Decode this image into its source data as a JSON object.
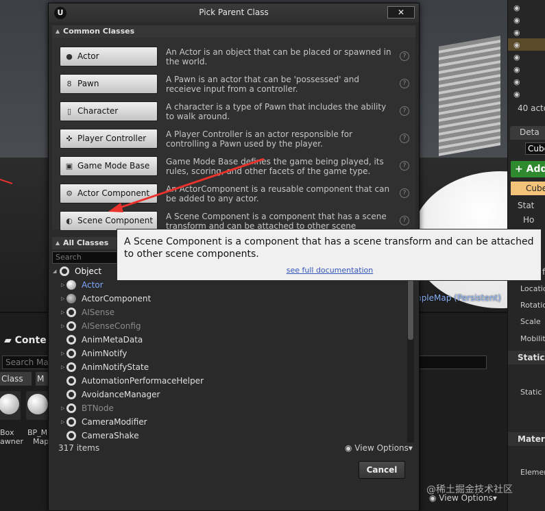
{
  "viewport": {
    "map_label": "mpleMap (Persistent)"
  },
  "right_panel": {
    "outliner_count": "40 acto",
    "details_tab": "Deta",
    "actor_name": "Cube",
    "add_label": "+ Add",
    "selected_component": "Cube",
    "static_section": "Stat",
    "sub_item": "Ho",
    "location": "Location",
    "rotation": "Rotatio",
    "scale": "Scale",
    "mobility": "Mobility",
    "static_mesh_section": "Static",
    "static_mesh_label": "Static M",
    "materials_section": "Materi",
    "element_label": "Elemen",
    "sidebar_letter": "f"
  },
  "content_browser": {
    "tab_label": "Conte",
    "search_placeholder": "Search Map",
    "chip_class": "Class",
    "chip_m": "M",
    "asset1_line1": "Box",
    "asset1_line2": "awner",
    "asset2_line1": "BP_M",
    "asset2_line2": "Map"
  },
  "dialog": {
    "title": "Pick Parent Class",
    "logo": "U",
    "close_label": "✕",
    "common_header": "Common Classes",
    "all_header": "All Classes",
    "search_placeholder": "Search",
    "common_classes": [
      {
        "label": "Actor",
        "icon": "sphere-icon",
        "desc": "An Actor is an object that can be placed or spawned in the world."
      },
      {
        "label": "Pawn",
        "icon": "pawn-icon",
        "desc": "A Pawn is an actor that can be 'possessed' and receieve input from a controller."
      },
      {
        "label": "Character",
        "icon": "character-icon",
        "desc": "A character is a type of Pawn that includes the ability to walk around."
      },
      {
        "label": "Player Controller",
        "icon": "controller-icon",
        "desc": "A Player Controller is an actor responsible for controlling a Pawn used by the player."
      },
      {
        "label": "Game Mode Base",
        "icon": "gamemode-icon",
        "desc": "Game Mode Base defines the game being played, its rules, scoring, and other facets of the game type."
      },
      {
        "label": "Actor Component",
        "icon": "component-icon",
        "desc": "An ActorComponent is a reusable component that can be added to any actor."
      },
      {
        "label": "Scene Component",
        "icon": "scene-component-icon",
        "desc": "A Scene Component is a component that has a scene transform and can be attached to other scene components."
      }
    ],
    "tree": [
      {
        "label": "Object",
        "depth": 0,
        "expand": "open",
        "kind": "ring",
        "color": "#ffffff"
      },
      {
        "label": "Actor",
        "depth": 1,
        "expand": "closed",
        "kind": "ball",
        "color": "#7fa6ff"
      },
      {
        "label": "ActorComponent",
        "depth": 1,
        "expand": "closed",
        "kind": "comp",
        "color": "#e0e0e0"
      },
      {
        "label": "AISense",
        "depth": 1,
        "expand": "closed",
        "kind": "ring",
        "color": "#8c8c8c"
      },
      {
        "label": "AISenseConfig",
        "depth": 1,
        "expand": "closed",
        "kind": "ring",
        "color": "#8c8c8c"
      },
      {
        "label": "AnimMetaData",
        "depth": 1,
        "expand": "none",
        "kind": "ring",
        "color": "#e0e0e0"
      },
      {
        "label": "AnimNotify",
        "depth": 1,
        "expand": "closed",
        "kind": "ring",
        "color": "#e0e0e0"
      },
      {
        "label": "AnimNotifyState",
        "depth": 1,
        "expand": "closed",
        "kind": "ring",
        "color": "#e0e0e0"
      },
      {
        "label": "AutomationPerformaceHelper",
        "depth": 1,
        "expand": "none",
        "kind": "ring",
        "color": "#e0e0e0"
      },
      {
        "label": "AvoidanceManager",
        "depth": 1,
        "expand": "none",
        "kind": "ring",
        "color": "#e0e0e0"
      },
      {
        "label": "BTNode",
        "depth": 1,
        "expand": "closed",
        "kind": "ring",
        "color": "#8c8c8c"
      },
      {
        "label": "CameraModifier",
        "depth": 1,
        "expand": "closed",
        "kind": "ring",
        "color": "#e0e0e0"
      },
      {
        "label": "CameraShake",
        "depth": 1,
        "expand": "none",
        "kind": "ring",
        "color": "#e0e0e0"
      }
    ],
    "items_count": "317 items",
    "view_options": "View Options",
    "cancel_label": "Cancel"
  },
  "tooltip": {
    "text": "A Scene Component is a component that has a scene transform and can be attached to other scene components.",
    "link": "see full documentation"
  },
  "bottom": {
    "view_options": "View Options",
    "watermark": "@稀土掘金技术社区"
  },
  "colors": {
    "arrow": "#e8322b",
    "link": "#3355bb",
    "add_button": "#2f8a2f",
    "selected": "#f3c37a"
  }
}
